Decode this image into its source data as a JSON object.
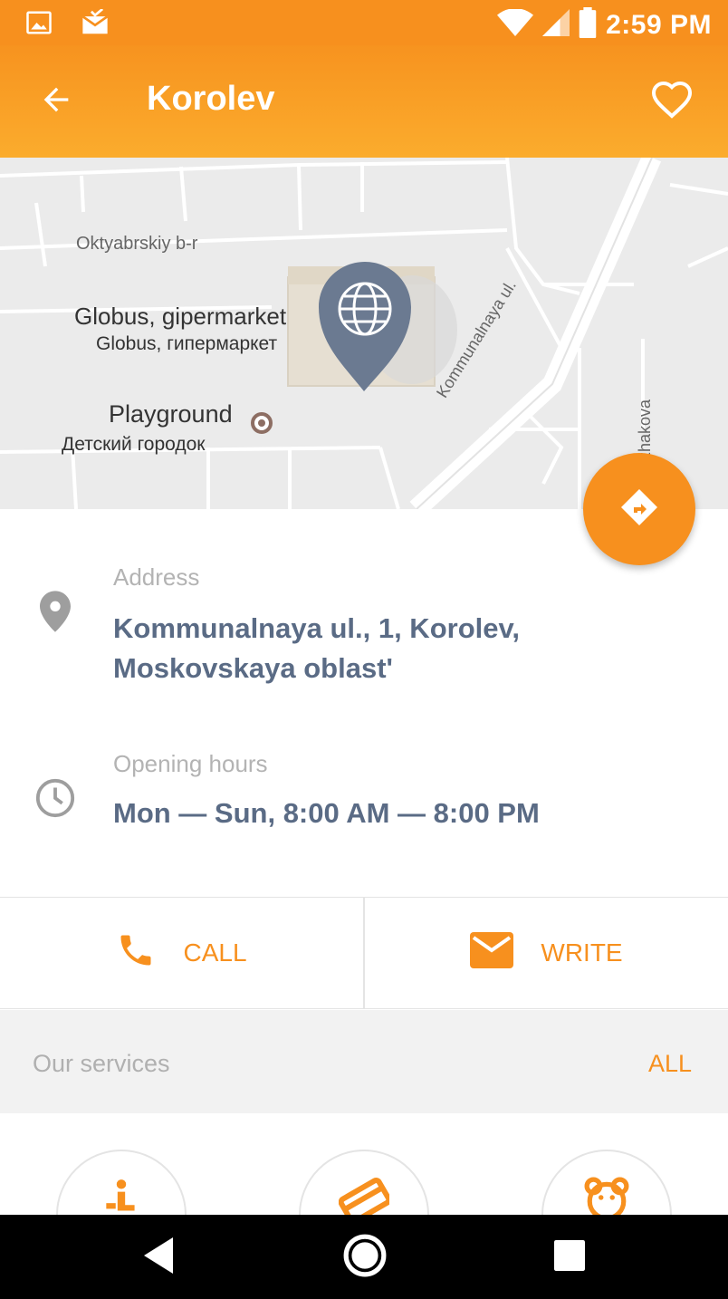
{
  "status_bar": {
    "time": "2:59 PM",
    "icons": [
      "image-icon",
      "mail-icon",
      "wifi-icon",
      "signal-icon",
      "battery-icon"
    ]
  },
  "toolbar": {
    "title": "Korolev",
    "back_icon": "arrow-back-icon",
    "favorite_icon": "heart-outline-icon"
  },
  "map": {
    "labels": {
      "street_1": "Oktyabrskiy b-r",
      "poi_1_en": "Globus, gipermarket",
      "poi_1_ru": "Globus, гипермаркет",
      "poi_2_en": "Playground",
      "poi_2_ru": "Детский городок",
      "street_2": "Kommunalnaya ul.",
      "street_3": "arzhakova"
    },
    "marker_icon": "globe-icon",
    "marker_color": "#6b7a91"
  },
  "route_button": {
    "icon": "directions-icon"
  },
  "details": {
    "address": {
      "label": "Address",
      "value": "Kommunalnaya ul., 1, Korolev, Moskovskaya oblast'",
      "icon": "location-pin-icon"
    },
    "hours": {
      "label": "Opening hours",
      "value": "Mon — Sun, 8:00 AM — 8:00 PM",
      "icon": "clock-icon"
    }
  },
  "actions": {
    "call_label": "CALL",
    "write_label": "WRITE"
  },
  "services": {
    "header_label": "Our services",
    "all_label": "ALL",
    "items": [
      {
        "icon": "person-icon"
      },
      {
        "icon": "credit-card-icon"
      },
      {
        "icon": "teddy-bear-icon"
      }
    ]
  },
  "nav_bar": {
    "icons": [
      "back-triangle-icon",
      "home-circle-icon",
      "recents-square-icon"
    ]
  },
  "colors": {
    "accent": "#f7901e",
    "text_value": "#5a6b85",
    "text_label": "#b3b3b3"
  }
}
